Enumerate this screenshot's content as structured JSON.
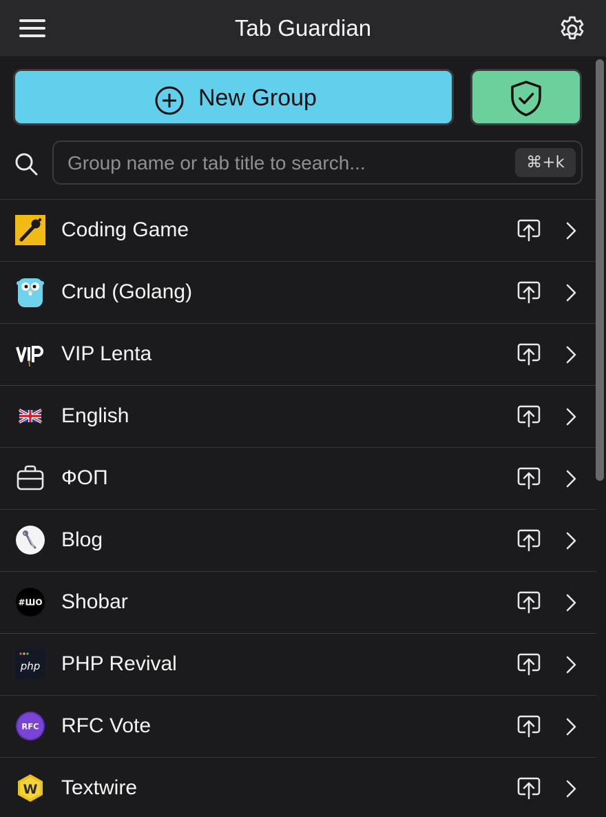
{
  "header": {
    "title": "Tab Guardian",
    "menu_icon": "hamburger-menu-icon",
    "settings_icon": "gear-icon"
  },
  "actions": {
    "new_group_label": "New Group",
    "new_group_icon": "plus-circle-icon",
    "new_group_color": "#62d0ec",
    "guard_icon": "shield-check-icon",
    "guard_color": "#6bd09c"
  },
  "search": {
    "placeholder": "Group name or tab title to search...",
    "value": "",
    "shortcut": "⌘+k"
  },
  "groups": [
    {
      "name": "Coding Game",
      "icon": "codingame-icon"
    },
    {
      "name": "Crud (Golang)",
      "icon": "golang-gopher-icon"
    },
    {
      "name": "VIP Lenta",
      "icon": "vip-logo-icon"
    },
    {
      "name": "English",
      "icon": "uk-flag-icon"
    },
    {
      "name": "ФОП",
      "icon": "briefcase-icon"
    },
    {
      "name": "Blog",
      "icon": "blog-logo-icon"
    },
    {
      "name": "Shobar",
      "icon": "shobar-logo-icon",
      "icon_text": "#ШО"
    },
    {
      "name": "PHP Revival",
      "icon": "php-logo-icon",
      "icon_text": "php"
    },
    {
      "name": "RFC Vote",
      "icon": "rfc-logo-icon",
      "icon_text": "RFC"
    },
    {
      "name": "Textwire",
      "icon": "textwire-logo-icon",
      "icon_text": "W"
    }
  ],
  "row_actions": {
    "open_icon": "upload-open-icon",
    "details_icon": "chevron-right-icon"
  }
}
